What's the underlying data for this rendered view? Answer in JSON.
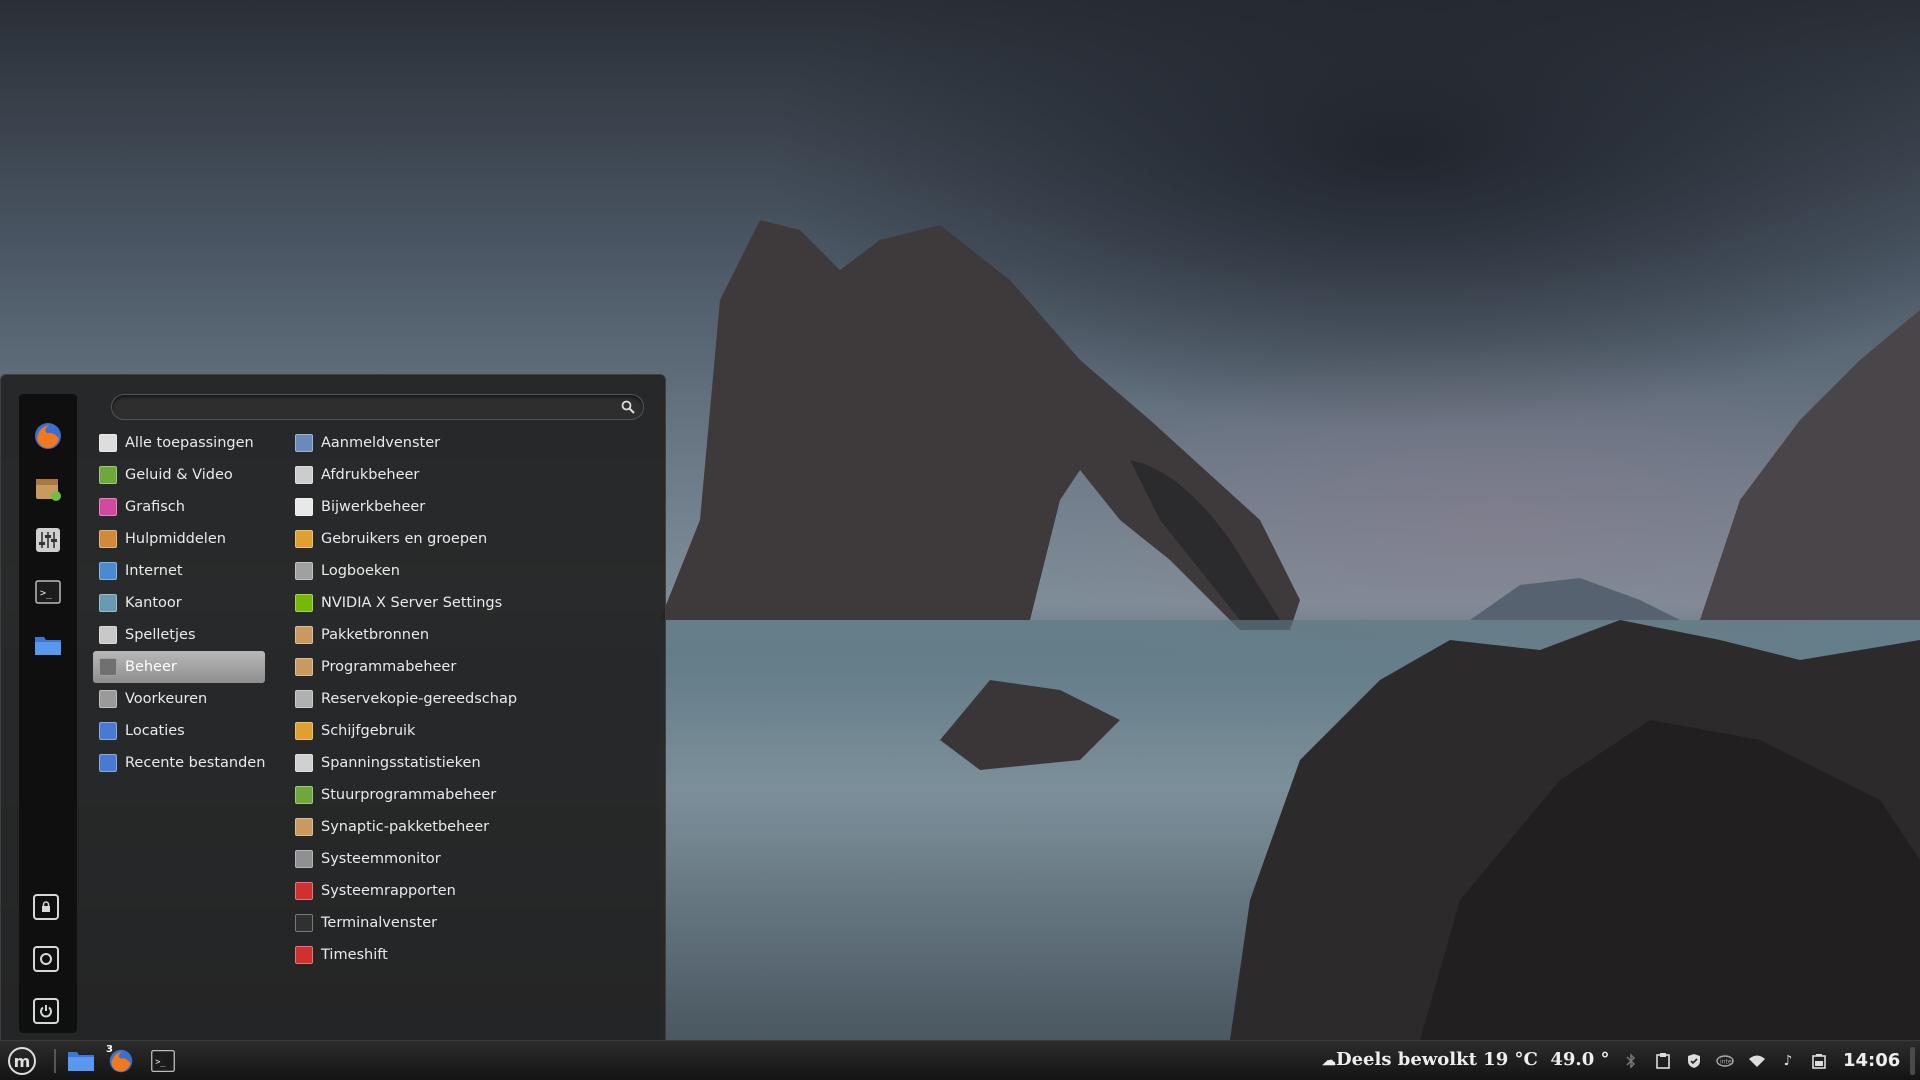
{
  "search": {
    "placeholder": "",
    "value": ""
  },
  "favorites": [
    {
      "name": "firefox-icon"
    },
    {
      "name": "software-manager-icon"
    },
    {
      "name": "system-settings-icon"
    },
    {
      "name": "terminal-icon"
    },
    {
      "name": "files-icon"
    }
  ],
  "system_buttons": [
    {
      "name": "lock-screen-icon"
    },
    {
      "name": "logout-icon"
    },
    {
      "name": "shutdown-icon"
    }
  ],
  "categories": [
    {
      "label": "Alle toepassingen",
      "icon": "grid-icon",
      "color": "#dddddd"
    },
    {
      "label": "Geluid & Video",
      "icon": "multimedia-icon",
      "color": "#6fa83a"
    },
    {
      "label": "Grafisch",
      "icon": "graphics-icon",
      "color": "#d04aa0"
    },
    {
      "label": "Hulpmiddelen",
      "icon": "accessories-icon",
      "color": "#d08a3a"
    },
    {
      "label": "Internet",
      "icon": "internet-icon",
      "color": "#4a8ad0"
    },
    {
      "label": "Kantoor",
      "icon": "office-icon",
      "color": "#6a9ab0"
    },
    {
      "label": "Spelletjes",
      "icon": "games-icon",
      "color": "#c8c8c8"
    },
    {
      "label": "Beheer",
      "icon": "administration-icon",
      "color": "#707070",
      "active": true
    },
    {
      "label": "Voorkeuren",
      "icon": "preferences-icon",
      "color": "#9a9a9a"
    },
    {
      "label": "Locaties",
      "icon": "folder-icon",
      "color": "#4a7ad0"
    },
    {
      "label": "Recente bestanden",
      "icon": "recent-files-icon",
      "color": "#4a7ad0"
    }
  ],
  "applications": [
    {
      "label": "Aanmeldvenster",
      "icon": "login-window-icon",
      "color": "#6a8ab8"
    },
    {
      "label": "Afdrukbeheer",
      "icon": "printer-icon",
      "color": "#cccccc"
    },
    {
      "label": "Bijwerkbeheer",
      "icon": "shield-icon",
      "color": "#e8e8e8"
    },
    {
      "label": "Gebruikers en groepen",
      "icon": "users-icon",
      "color": "#e0a030"
    },
    {
      "label": "Logboeken",
      "icon": "logs-icon",
      "color": "#a0a0a0"
    },
    {
      "label": "NVIDIA X Server Settings",
      "icon": "nvidia-icon",
      "color": "#76b900"
    },
    {
      "label": "Pakketbronnen",
      "icon": "package-sources-icon",
      "color": "#c89a60"
    },
    {
      "label": "Programmabeheer",
      "icon": "software-manager-icon",
      "color": "#c89a60"
    },
    {
      "label": "Reservekopie-gereedschap",
      "icon": "backup-icon",
      "color": "#b0b0b0"
    },
    {
      "label": "Schijfgebruik",
      "icon": "disk-usage-icon",
      "color": "#e0a030"
    },
    {
      "label": "Spanningsstatistieken",
      "icon": "power-statistics-icon",
      "color": "#d0d0d0"
    },
    {
      "label": "Stuurprogrammabeheer",
      "icon": "driver-manager-icon",
      "color": "#6fa83a"
    },
    {
      "label": "Synaptic-pakketbeheer",
      "icon": "synaptic-icon",
      "color": "#c89a60"
    },
    {
      "label": "Systeemmonitor",
      "icon": "system-monitor-icon",
      "color": "#909090"
    },
    {
      "label": "Systeemrapporten",
      "icon": "system-reports-icon",
      "color": "#d03030"
    },
    {
      "label": "Terminalvenster",
      "icon": "terminal-icon",
      "color": "#303030"
    },
    {
      "label": "Timeshift",
      "icon": "timeshift-icon",
      "color": "#d03030"
    }
  ],
  "taskbar": {
    "launchers": [
      {
        "name": "files-icon"
      },
      {
        "name": "firefox-icon",
        "badge": "3"
      },
      {
        "name": "terminal-icon"
      }
    ],
    "weather": "Deels bewolkt 19 °C",
    "temperature": "49.0 °",
    "clock": "14:06",
    "tray_icons": [
      "bluetooth-icon",
      "clipboard-icon",
      "update-shield-icon",
      "intel-icon",
      "wifi-icon",
      "sound-icon",
      "battery-icon"
    ]
  }
}
